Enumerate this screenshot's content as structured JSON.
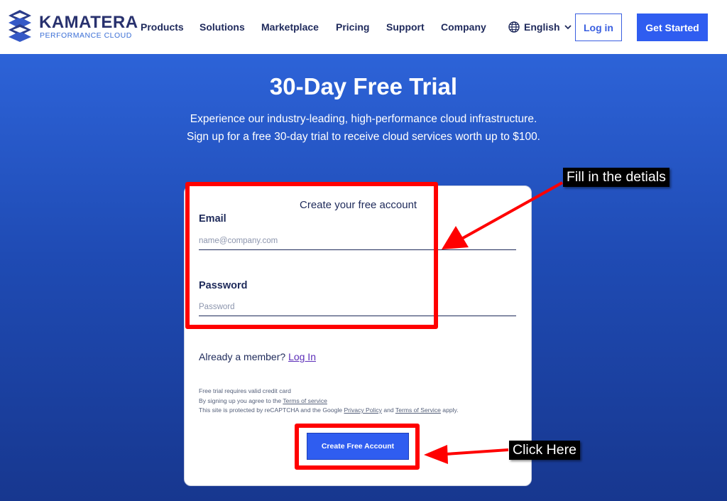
{
  "header": {
    "brand_name": "KAMATERA",
    "brand_tagline": "PERFORMANCE CLOUD",
    "nav": [
      {
        "label": "Products"
      },
      {
        "label": "Solutions"
      },
      {
        "label": "Marketplace"
      },
      {
        "label": "Pricing"
      },
      {
        "label": "Support"
      },
      {
        "label": "Company"
      }
    ],
    "language": "English",
    "login_label": "Log in",
    "get_started_label": "Get Started"
  },
  "hero": {
    "title": "30-Day Free Trial",
    "subtitle_line1": "Experience our industry-leading, high-performance cloud infrastructure.",
    "subtitle_line2": "Sign up for a free 30-day trial to receive cloud services worth up to $100."
  },
  "form": {
    "title": "Create your free account",
    "email_label": "Email",
    "email_placeholder": "name@company.com",
    "email_value": "",
    "password_label": "Password",
    "password_placeholder": "Password",
    "password_value": "",
    "member_text": "Already a member?",
    "member_link": "Log In",
    "fine_line1": "Free trial requires valid credit card",
    "fine_line2_prefix": "By signing up you agree to the",
    "fine_line2_link": "Terms of service",
    "fine_line3_prefix": "This site is protected by reCAPTCHA and the Google",
    "fine_line3_link1": "Privacy Policy",
    "fine_line3_and": "and",
    "fine_line3_link2": "Terms of Service",
    "fine_line3_suffix": "apply.",
    "submit_label": "Create Free Account"
  },
  "annotations": {
    "fill_callout": "Fill in the detials",
    "click_callout": "Click Here",
    "highlight_color": "#ff0000"
  },
  "colors": {
    "brand_navy": "#28316e",
    "accent_blue": "#2f5df0",
    "hero_top": "#2d63d8",
    "hero_bottom": "#17378f"
  }
}
